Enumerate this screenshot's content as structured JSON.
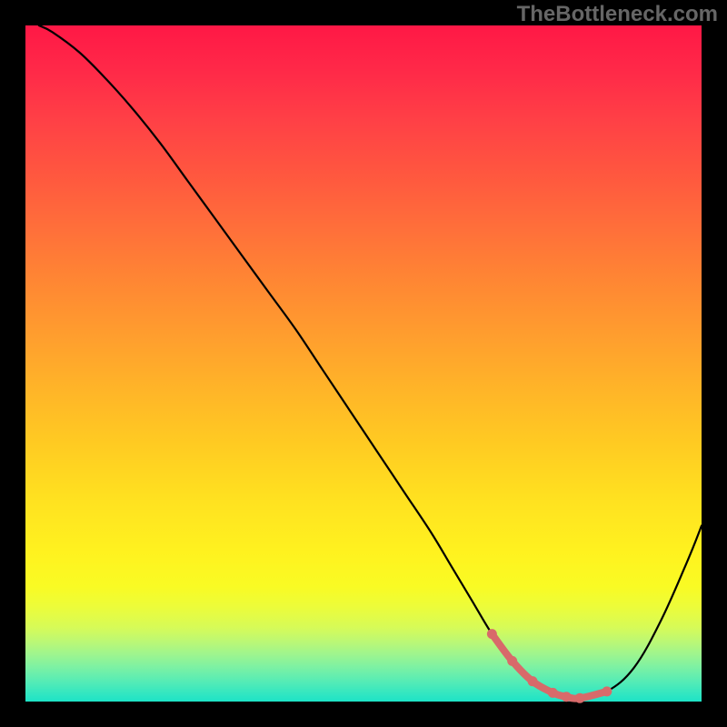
{
  "watermark": "TheBottleneck.com",
  "colors": {
    "background": "#000000",
    "curve": "#000000",
    "accent": "#d86a6a",
    "gradient_top": "#ff1846",
    "gradient_bottom": "#1de3c6"
  },
  "chart_data": {
    "type": "line",
    "title": "",
    "xlabel": "",
    "ylabel": "",
    "xlim": [
      0,
      100
    ],
    "ylim": [
      0,
      100
    ],
    "series": [
      {
        "name": "bottleneck_curve",
        "x": [
          2,
          4,
          8,
          12,
          16,
          20,
          24,
          28,
          32,
          36,
          40,
          44,
          48,
          52,
          56,
          60,
          63,
          66,
          69,
          72,
          75,
          78,
          80,
          82,
          86,
          90,
          94,
          98,
          100
        ],
        "values": [
          100,
          99,
          96,
          92,
          87.5,
          82.5,
          77,
          71.5,
          66,
          60.5,
          55,
          49,
          43,
          37,
          31,
          25,
          20,
          15,
          10,
          6,
          3,
          1.3,
          0.7,
          0.5,
          1.5,
          5,
          12,
          21,
          26
        ]
      },
      {
        "name": "optimal_region",
        "x": [
          69,
          72,
          75,
          78,
          80,
          82,
          86
        ],
        "values": [
          10,
          6,
          3,
          1.3,
          0.7,
          0.5,
          1.5
        ]
      }
    ]
  }
}
